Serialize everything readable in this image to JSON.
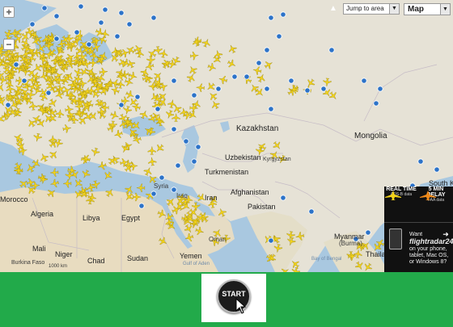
{
  "map": {
    "jump_to_area": "Jump to area",
    "map_type": "Map",
    "zoom_in": "+",
    "zoom_out": "−",
    "labels": {
      "kazakhstan": "Kazakhstan",
      "mongolia": "Mongolia",
      "uzbekistan": "Uzbekistan",
      "kyrgyzstan": "Kyrgyzstan",
      "turkmenistan": "Turkmenistan",
      "afghanistan": "Afghanistan",
      "iran": "Iran",
      "syria": "Syria",
      "iraq": "Iraq",
      "pakistan": "Pakistan",
      "morocco": "Morocco",
      "algeria": "Algeria",
      "libya": "Libya",
      "egypt": "Egypt",
      "mali": "Mali",
      "niger": "Niger",
      "chad": "Chad",
      "sudan": "Sudan",
      "yemen": "Yemen",
      "oman": "Oman",
      "burkina_faso": "Burkina Faso",
      "myanmar": "Myanmar",
      "burma": "(Burma)",
      "thailand": "Thaila",
      "south_korea": "South K",
      "bay_of_bengal": "Bay of Bengal",
      "gulf_of_aden": "Gulf of Aden",
      "scale": "1000 km"
    }
  },
  "ad": {
    "realtime_title": "REAL TIME",
    "realtime_sub": "ADS-B data",
    "delay_title": "5 MIN DELAY",
    "delay_sub": "FAA data",
    "want": "Want",
    "brand": "flightradar24",
    "tail": "on your phone, tablet, Mac OS, or Windows 8?"
  },
  "start_button": {
    "label": "START"
  },
  "colors": {
    "water": "#a9c8e0",
    "plane": "#f3d31a",
    "airport": "#2d73c8",
    "footer": "#22aa4a"
  }
}
